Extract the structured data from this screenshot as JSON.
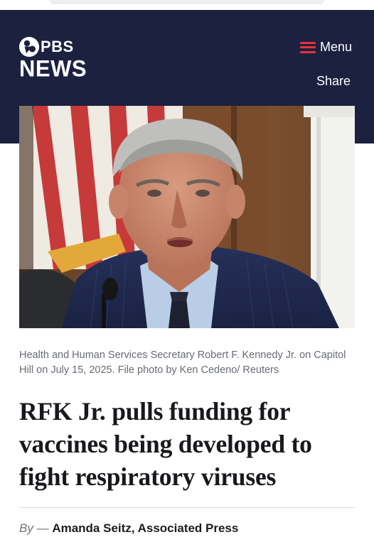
{
  "header": {
    "logo_top": "PBS",
    "logo_bottom": "NEWS",
    "menu_label": "Menu",
    "share_label": "Share",
    "accent_color": "#e6323d",
    "background_color": "#1b213f"
  },
  "article": {
    "caption": "Health and Human Services Secretary Robert F. Kennedy Jr. on Capitol Hill on July 15, 2025. File photo by Ken Cedeno/ Reuters",
    "headline": "RFK Jr. pulls funding for vaccines being developed to fight respiratory viruses",
    "byline": {
      "prefix": "By",
      "dash": "—",
      "author": "Amanda Seitz, Associated Press"
    }
  },
  "icons": {
    "logo": "pbs-logo-icon",
    "menu": "hamburger-menu-icon"
  }
}
